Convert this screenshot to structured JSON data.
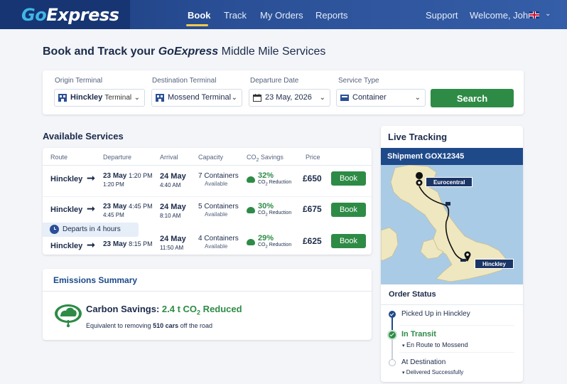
{
  "nav": {
    "logo_go": "Go",
    "logo_rest": "Express",
    "items": [
      "Book",
      "Track",
      "My Orders",
      "Reports"
    ],
    "support": "Support",
    "welcome": "Welcome, John"
  },
  "page": {
    "title_pre": "Book and Track your ",
    "title_brand": "GoExpress",
    "title_post": " Middle Mile Services"
  },
  "search": {
    "origin_label": "Origin Terminal",
    "origin_value": "Hinckley",
    "origin_suffix": "Terminal",
    "dest_label": "Destination Terminal",
    "dest_value": "Mossend Terminal",
    "date_label": "Departure Date",
    "date_value": "23 May, 2026",
    "service_label": "Service Type",
    "service_value": "Container",
    "button": "Search"
  },
  "services": {
    "title": "Available Services",
    "columns": [
      "Route",
      "Departure",
      "Arrival",
      "Capacity",
      "CO",
      "2",
      " Savings",
      "Price"
    ],
    "rows": [
      {
        "route": "Hinckley",
        "dep_date": "23 May",
        "dep_time": "1:20 PM",
        "dep_sub": "1:20 PM",
        "arr_date": "24 May",
        "arr_sub": "4:40 AM",
        "cap": "7 Containers",
        "cap_sub": "Available",
        "co2": "32%",
        "price": "£650",
        "book": "Book"
      },
      {
        "route": "Hinckley",
        "dep_date": "23 May",
        "dep_time": "4:45 PM",
        "dep_sub": "4:45 PM",
        "arr_date": "24 May",
        "arr_sub": "8:10 AM",
        "cap": "5 Containers",
        "cap_sub": "Available",
        "co2": "30%",
        "price": "£675",
        "book": "Book"
      },
      {
        "route": "Hinckley",
        "dep_date": "23 May",
        "dep_time": "8:15 PM",
        "dep_sub": "",
        "arr_date": "24 May",
        "arr_sub": "11:50 AM",
        "cap": "4 Containers",
        "cap_sub": "Available",
        "co2": "29%",
        "price": "£625",
        "book": "Book"
      }
    ],
    "co2_sub_a": "CO",
    "co2_sub_b": "2",
    "co2_sub_c": " Reduction",
    "departs_note": "Departs in 4 hours"
  },
  "emissions": {
    "title": "Emissions Summary",
    "label": "Carbon Savings: ",
    "value_a": "2.4 t CO",
    "value_b": "2",
    "value_c": " Reduced",
    "sub_pre": "Equivalent to removing ",
    "sub_bold": "510 cars",
    "sub_post": " off the road"
  },
  "tracking": {
    "title": "Live Tracking",
    "shipment": "Shipment GOX12345",
    "map_origin": "Eurocentral",
    "map_dest": "Hinckley",
    "order_status_title": "Order Status",
    "steps": [
      {
        "label": "Picked Up in Hinckley",
        "sub": ""
      },
      {
        "label": "In Transit",
        "sub": "En Route to Mossend"
      },
      {
        "label": "At Destination",
        "sub": "Delivered Successfully"
      }
    ]
  },
  "colors": {
    "nav_bg": "#2a4f96",
    "accent_green": "#2e8b46",
    "navy": "#1f4a8a",
    "logo_accent": "#3fb6e8"
  }
}
